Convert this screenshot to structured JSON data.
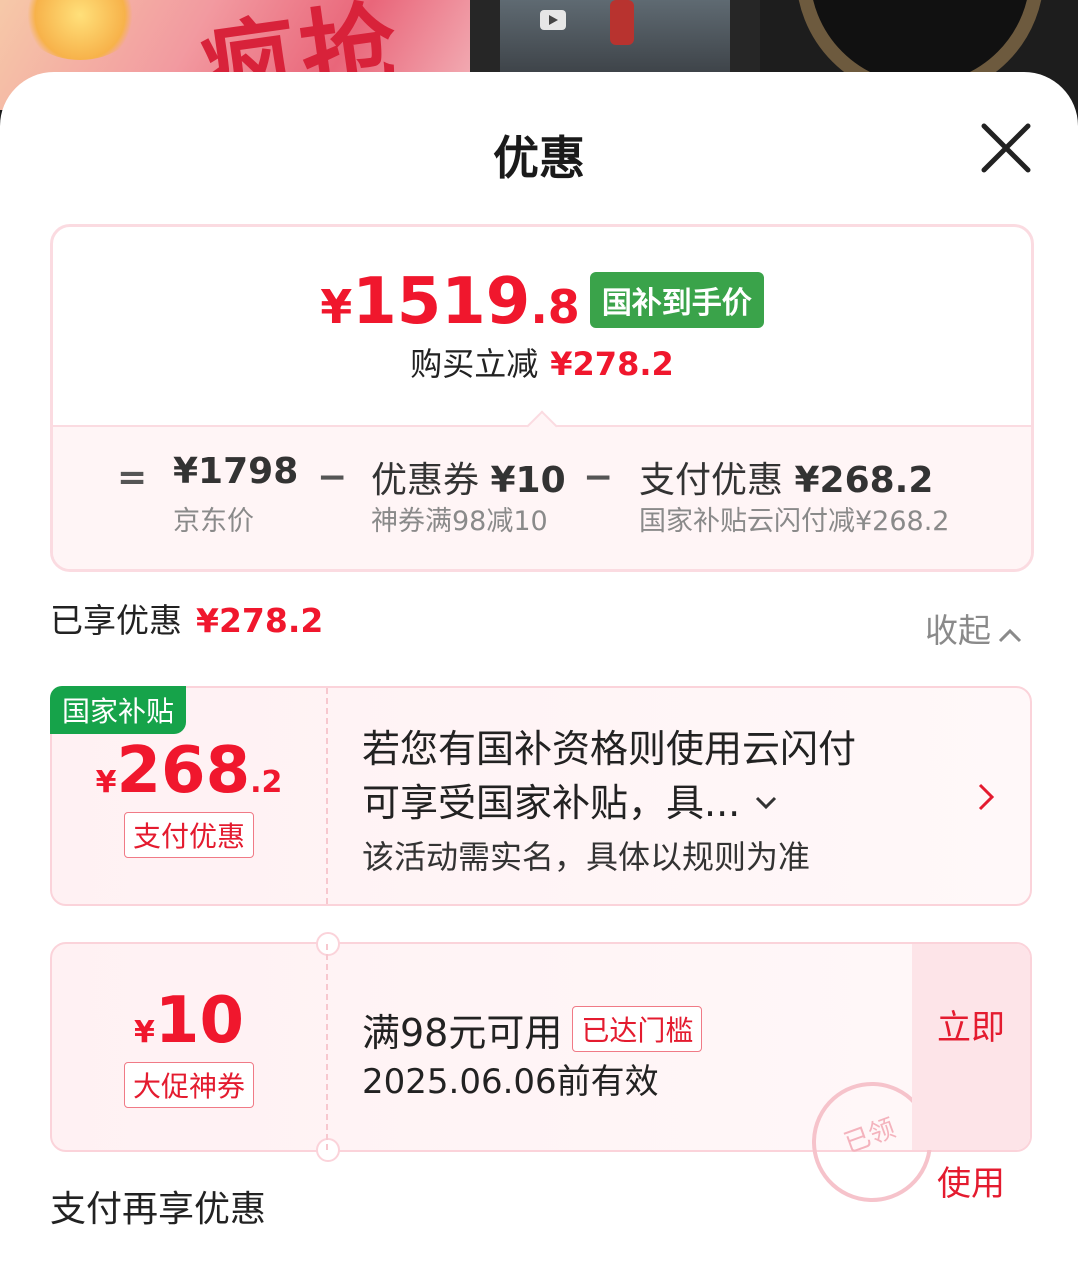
{
  "sheet": {
    "title": "优惠"
  },
  "summary": {
    "price_yen": "¥",
    "price_int": "1519",
    "price_dec": ".8",
    "price_tag": "国补到手价",
    "save_label": "购买立减",
    "save_amount": "¥278.2",
    "breakdown": {
      "eq": "=",
      "jd_price": "¥1798",
      "jd_price_label": "京东价",
      "minus1": "−",
      "coupon_label": "优惠券",
      "coupon_amount": "¥10",
      "coupon_note": "神券满98减10",
      "minus2": "−",
      "pay_label": "支付优惠",
      "pay_amount": "¥268.2",
      "pay_note": "国家补贴云闪付减¥268.2"
    }
  },
  "enjoyed": {
    "label": "已享优惠",
    "amount": "¥278.2",
    "collapse": "收起"
  },
  "offer1": {
    "corner_tag": "国家补贴",
    "yen": "¥",
    "amount_int": "268",
    "amount_dec": ".2",
    "type": "支付优惠",
    "desc_line1": "若您有国补资格则使用云闪付",
    "desc_line2": "可享受国家补贴，具...",
    "note": "该活动需实名，具体以规则为准"
  },
  "offer2": {
    "yen": "¥",
    "amount": "10",
    "type": "大促神券",
    "condition": "满98元可用",
    "condition_tag": "已达门槛",
    "validity": "2025.06.06前有效",
    "use_line1": "立即",
    "use_line2": "使用",
    "stamp": "已领"
  },
  "next_section": "支付再享优惠",
  "colors": {
    "accent_red": "#f0172d",
    "green": "#3aa34a",
    "pink_border": "#fbdbe1"
  }
}
